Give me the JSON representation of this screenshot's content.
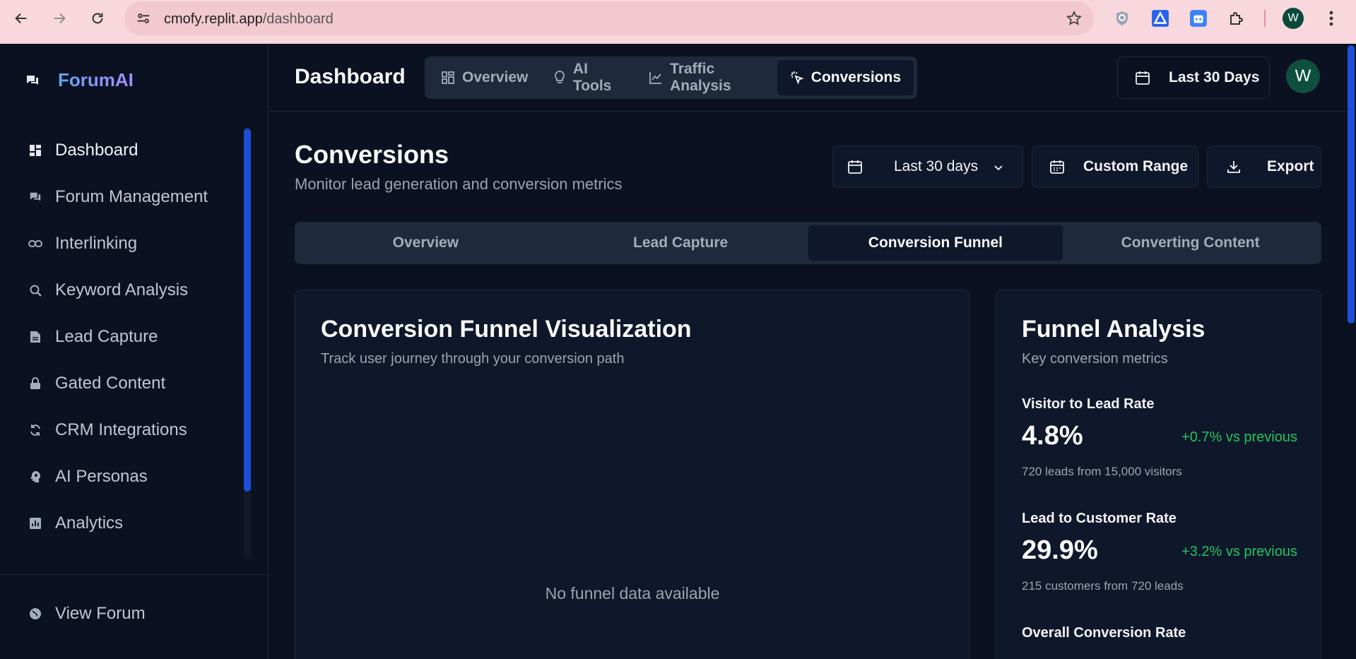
{
  "browser": {
    "url_host": "cmofy.replit.app",
    "url_path": "/dashboard",
    "profile_initial": "W"
  },
  "sidebar": {
    "brand": "ForumAI",
    "items": [
      {
        "label": "Dashboard",
        "icon": "dashboard-icon"
      },
      {
        "label": "Forum Management",
        "icon": "forum-icon"
      },
      {
        "label": "Interlinking",
        "icon": "link-icon"
      },
      {
        "label": "Keyword Analysis",
        "icon": "keyword-search-icon"
      },
      {
        "label": "Lead Capture",
        "icon": "document-icon"
      },
      {
        "label": "Gated Content",
        "icon": "lock-icon"
      },
      {
        "label": "CRM Integrations",
        "icon": "sync-icon"
      },
      {
        "label": "AI Personas",
        "icon": "persona-icon"
      },
      {
        "label": "Analytics",
        "icon": "analytics-icon"
      }
    ],
    "footer": {
      "label": "View Forum",
      "icon": "globe-icon"
    }
  },
  "header": {
    "title": "Dashboard",
    "tabs": [
      {
        "label": "Overview",
        "icon": "grid-icon"
      },
      {
        "label": "AI Tools",
        "icon": "lightbulb-icon"
      },
      {
        "label": "Traffic Analysis",
        "icon": "line-chart-icon"
      },
      {
        "label": "Conversions",
        "icon": "cursor-click-icon"
      }
    ],
    "active_tab": "Conversions",
    "range_label": "Last 30 Days",
    "avatar_initial": "W"
  },
  "page": {
    "title": "Conversions",
    "subtitle": "Monitor lead generation and conversion metrics",
    "range_select": "Last 30 days",
    "custom_range": "Custom Range",
    "export": "Export",
    "subtabs": [
      "Overview",
      "Lead Capture",
      "Conversion Funnel",
      "Converting Content"
    ],
    "active_subtab": "Conversion Funnel"
  },
  "funnel_card": {
    "title": "Conversion Funnel Visualization",
    "subtitle": "Track user journey through your conversion path",
    "empty": "No funnel data available"
  },
  "analysis_card": {
    "title": "Funnel Analysis",
    "subtitle": "Key conversion metrics",
    "metrics": [
      {
        "label": "Visitor to Lead Rate",
        "value": "4.8%",
        "delta": "+0.7% vs previous",
        "note": "720 leads from 15,000 visitors"
      },
      {
        "label": "Lead to Customer Rate",
        "value": "29.9%",
        "delta": "+3.2% vs previous",
        "note": "215 customers from 720 leads"
      },
      {
        "label": "Overall Conversion Rate"
      }
    ]
  },
  "colors": {
    "background": "#0b1120",
    "panel": "#0f172a",
    "tab_track": "#1e293b",
    "accent": "#1d4ed8",
    "positive": "#22c55e"
  }
}
